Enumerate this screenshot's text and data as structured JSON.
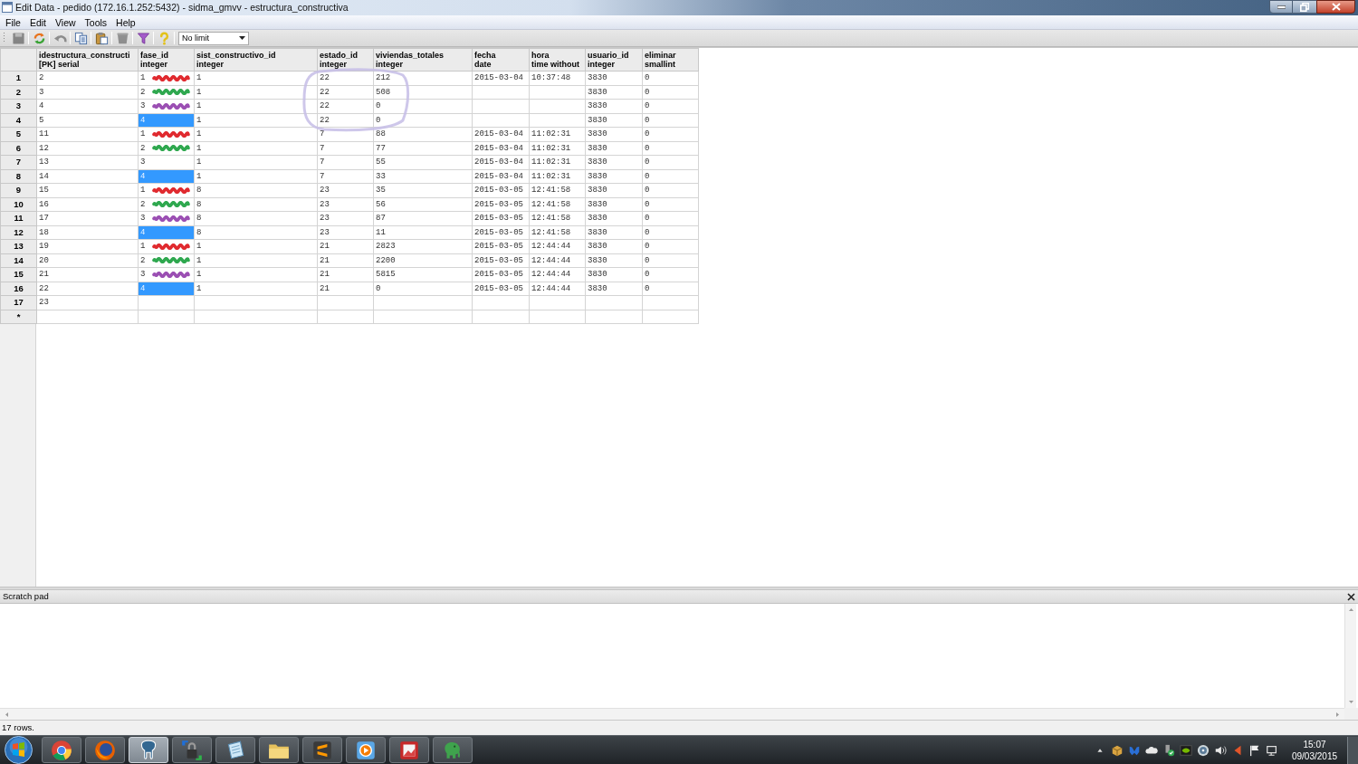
{
  "window": {
    "title": "Edit Data - pedido (172.16.1.252:5432) - sidma_gmvv - estructura_constructiva"
  },
  "menu": [
    "File",
    "Edit",
    "View",
    "Tools",
    "Help"
  ],
  "toolbar": {
    "buttons": [
      {
        "kind": "save",
        "disabled": true
      },
      {
        "kind": "refresh",
        "disabled": false
      },
      {
        "kind": "undo",
        "disabled": true
      },
      {
        "kind": "copy",
        "disabled": false
      },
      {
        "kind": "paste",
        "disabled": false
      },
      {
        "kind": "delete",
        "disabled": true
      },
      {
        "kind": "filter",
        "disabled": false
      },
      {
        "kind": "help",
        "disabled": false
      }
    ],
    "row_limit": {
      "value": "No limit"
    }
  },
  "table": {
    "columns": [
      {
        "name": "idestructura_constructi",
        "type": "[PK] serial"
      },
      {
        "name": "fase_id",
        "type": "integer"
      },
      {
        "name": "sist_constructivo_id",
        "type": "integer"
      },
      {
        "name": "estado_id",
        "type": "integer"
      },
      {
        "name": "viviendas_totales",
        "type": "integer"
      },
      {
        "name": "fecha",
        "type": "date"
      },
      {
        "name": "hora",
        "type": "time without"
      },
      {
        "name": "usuario_id",
        "type": "integer"
      },
      {
        "name": "eliminar",
        "type": "smallint"
      }
    ],
    "rows": [
      {
        "number": "1",
        "cells": [
          {
            "text": "2",
            "selected": false
          },
          {
            "text": "1",
            "selected": false,
            "color": "#e02a2f"
          },
          {
            "text": "1",
            "selected": false
          },
          {
            "text": "22",
            "selected": false
          },
          {
            "text": "212",
            "selected": false
          },
          {
            "text": "2015-03-04",
            "selected": false
          },
          {
            "text": "10:37:48",
            "selected": false
          },
          {
            "text": "3830",
            "selected": false
          },
          {
            "text": "0",
            "selected": false
          }
        ]
      },
      {
        "number": "2",
        "cells": [
          {
            "text": "3",
            "selected": false
          },
          {
            "text": "2",
            "selected": false,
            "color": "#2fa84f"
          },
          {
            "text": "1",
            "selected": false
          },
          {
            "text": "22",
            "selected": false
          },
          {
            "text": "508",
            "selected": false
          },
          {
            "selected": false
          },
          {
            "selected": false
          },
          {
            "text": "3830",
            "selected": false
          },
          {
            "text": "0",
            "selected": false
          }
        ]
      },
      {
        "number": "3",
        "cells": [
          {
            "text": "4",
            "selected": false
          },
          {
            "text": "3",
            "selected": false,
            "color": "#9b4fb3"
          },
          {
            "text": "1",
            "selected": false
          },
          {
            "text": "22",
            "selected": false
          },
          {
            "text": "0",
            "selected": false
          },
          {
            "selected": false
          },
          {
            "selected": false
          },
          {
            "text": "3830",
            "selected": false
          },
          {
            "text": "0",
            "selected": false
          }
        ]
      },
      {
        "number": "4",
        "cells": [
          {
            "text": "5",
            "selected": false
          },
          {
            "text": "4",
            "selected": true
          },
          {
            "text": "1",
            "selected": false
          },
          {
            "text": "22",
            "selected": false
          },
          {
            "text": "0",
            "selected": false
          },
          {
            "selected": false
          },
          {
            "selected": false
          },
          {
            "text": "3830",
            "selected": false
          },
          {
            "text": "0",
            "selected": false
          }
        ]
      },
      {
        "number": "5",
        "cells": [
          {
            "text": "11",
            "selected": false
          },
          {
            "text": "1",
            "selected": false,
            "color": "#e02a2f"
          },
          {
            "text": "1",
            "selected": false
          },
          {
            "text": "7",
            "selected": false
          },
          {
            "text": "88",
            "selected": false
          },
          {
            "text": "2015-03-04",
            "selected": false
          },
          {
            "text": "11:02:31",
            "selected": false
          },
          {
            "text": "3830",
            "selected": false
          },
          {
            "text": "0",
            "selected": false
          }
        ]
      },
      {
        "number": "6",
        "cells": [
          {
            "text": "12",
            "selected": false
          },
          {
            "text": "2",
            "selected": false,
            "color": "#2fa84f"
          },
          {
            "text": "1",
            "selected": false
          },
          {
            "text": "7",
            "selected": false
          },
          {
            "text": "77",
            "selected": false
          },
          {
            "text": "2015-03-04",
            "selected": false
          },
          {
            "text": "11:02:31",
            "selected": false
          },
          {
            "text": "3830",
            "selected": false
          },
          {
            "text": "0",
            "selected": false
          }
        ]
      },
      {
        "number": "7",
        "cells": [
          {
            "text": "13",
            "selected": false
          },
          {
            "text": "3",
            "selected": false
          },
          {
            "text": "1",
            "selected": false
          },
          {
            "text": "7",
            "selected": false
          },
          {
            "text": "55",
            "selected": false
          },
          {
            "text": "2015-03-04",
            "selected": false
          },
          {
            "text": "11:02:31",
            "selected": false
          },
          {
            "text": "3830",
            "selected": false
          },
          {
            "text": "0",
            "selected": false
          }
        ]
      },
      {
        "number": "8",
        "cells": [
          {
            "text": "14",
            "selected": false
          },
          {
            "text": "4",
            "selected": true
          },
          {
            "text": "1",
            "selected": false
          },
          {
            "text": "7",
            "selected": false
          },
          {
            "text": "33",
            "selected": false
          },
          {
            "text": "2015-03-04",
            "selected": false
          },
          {
            "text": "11:02:31",
            "selected": false
          },
          {
            "text": "3830",
            "selected": false
          },
          {
            "text": "0",
            "selected": false
          }
        ]
      },
      {
        "number": "9",
        "cells": [
          {
            "text": "15",
            "selected": false
          },
          {
            "text": "1",
            "selected": false,
            "color": "#e02a2f"
          },
          {
            "text": "8",
            "selected": false
          },
          {
            "text": "23",
            "selected": false
          },
          {
            "text": "35",
            "selected": false
          },
          {
            "text": "2015-03-05",
            "selected": false
          },
          {
            "text": "12:41:58",
            "selected": false
          },
          {
            "text": "3830",
            "selected": false
          },
          {
            "text": "0",
            "selected": false
          }
        ]
      },
      {
        "number": "10",
        "cells": [
          {
            "text": "16",
            "selected": false
          },
          {
            "text": "2",
            "selected": false,
            "color": "#2fa84f"
          },
          {
            "text": "8",
            "selected": false
          },
          {
            "text": "23",
            "selected": false
          },
          {
            "text": "56",
            "selected": false
          },
          {
            "text": "2015-03-05",
            "selected": false
          },
          {
            "text": "12:41:58",
            "selected": false
          },
          {
            "text": "3830",
            "selected": false
          },
          {
            "text": "0",
            "selected": false
          }
        ]
      },
      {
        "number": "11",
        "cells": [
          {
            "text": "17",
            "selected": false
          },
          {
            "text": "3",
            "selected": false,
            "color": "#9b4fb3"
          },
          {
            "text": "8",
            "selected": false
          },
          {
            "text": "23",
            "selected": false
          },
          {
            "text": "87",
            "selected": false
          },
          {
            "text": "2015-03-05",
            "selected": false
          },
          {
            "text": "12:41:58",
            "selected": false
          },
          {
            "text": "3830",
            "selected": false
          },
          {
            "text": "0",
            "selected": false
          }
        ]
      },
      {
        "number": "12",
        "cells": [
          {
            "text": "18",
            "selected": false
          },
          {
            "text": "4",
            "selected": true
          },
          {
            "text": "8",
            "selected": false
          },
          {
            "text": "23",
            "selected": false
          },
          {
            "text": "11",
            "selected": false
          },
          {
            "text": "2015-03-05",
            "selected": false
          },
          {
            "text": "12:41:58",
            "selected": false
          },
          {
            "text": "3830",
            "selected": false
          },
          {
            "text": "0",
            "selected": false
          }
        ]
      },
      {
        "number": "13",
        "cells": [
          {
            "text": "19",
            "selected": false
          },
          {
            "text": "1",
            "selected": false,
            "color": "#e02a2f"
          },
          {
            "text": "1",
            "selected": false
          },
          {
            "text": "21",
            "selected": false
          },
          {
            "text": "2823",
            "selected": false
          },
          {
            "text": "2015-03-05",
            "selected": false
          },
          {
            "text": "12:44:44",
            "selected": false
          },
          {
            "text": "3830",
            "selected": false
          },
          {
            "text": "0",
            "selected": false
          }
        ]
      },
      {
        "number": "14",
        "cells": [
          {
            "text": "20",
            "selected": false
          },
          {
            "text": "2",
            "selected": false,
            "color": "#2fa84f"
          },
          {
            "text": "1",
            "selected": false
          },
          {
            "text": "21",
            "selected": false
          },
          {
            "text": "2200",
            "selected": false
          },
          {
            "text": "2015-03-05",
            "selected": false
          },
          {
            "text": "12:44:44",
            "selected": false
          },
          {
            "text": "3830",
            "selected": false
          },
          {
            "text": "0",
            "selected": false
          }
        ]
      },
      {
        "number": "15",
        "cells": [
          {
            "text": "21",
            "selected": false
          },
          {
            "text": "3",
            "selected": false,
            "color": "#9b4fb3"
          },
          {
            "text": "1",
            "selected": false
          },
          {
            "text": "21",
            "selected": false
          },
          {
            "text": "5815",
            "selected": false
          },
          {
            "text": "2015-03-05",
            "selected": false
          },
          {
            "text": "12:44:44",
            "selected": false
          },
          {
            "text": "3830",
            "selected": false
          },
          {
            "text": "0",
            "selected": false
          }
        ]
      },
      {
        "number": "16",
        "cells": [
          {
            "text": "22",
            "selected": false
          },
          {
            "text": "4",
            "selected": true
          },
          {
            "text": "1",
            "selected": false
          },
          {
            "text": "21",
            "selected": false
          },
          {
            "text": "0",
            "selected": false
          },
          {
            "text": "2015-03-05",
            "selected": false
          },
          {
            "text": "12:44:44",
            "selected": false
          },
          {
            "text": "3830",
            "selected": false
          },
          {
            "text": "0",
            "selected": false
          }
        ]
      },
      {
        "number": "17",
        "cells": [
          {
            "text": "23",
            "selected": false
          }
        ]
      },
      {
        "number": "*"
      }
    ]
  },
  "scratch_pad": {
    "title": "Scratch pad"
  },
  "status_bar": {
    "text": "17 rows."
  },
  "taskbar": {
    "clock": {
      "time": "15:07",
      "date": "09/03/2015"
    }
  }
}
